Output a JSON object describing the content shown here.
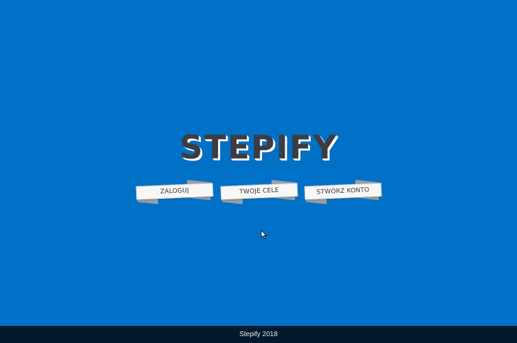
{
  "app": {
    "logo_text": "STEPIFY"
  },
  "nav": {
    "items": [
      {
        "label": "ZALOGUJ"
      },
      {
        "label": "TWOJE CELE"
      },
      {
        "label": "STWÓRZ KONTO"
      }
    ]
  },
  "footer": {
    "text": "Stepify 2018"
  },
  "colors": {
    "background": "#0171c8",
    "footer_bg": "#02192c",
    "logo_text": "#3b3d44",
    "ribbon_face": "#f7f7f7",
    "ribbon_fold": "#9a9ea4"
  },
  "icons": {
    "cursor": "mouse-pointer-icon"
  }
}
